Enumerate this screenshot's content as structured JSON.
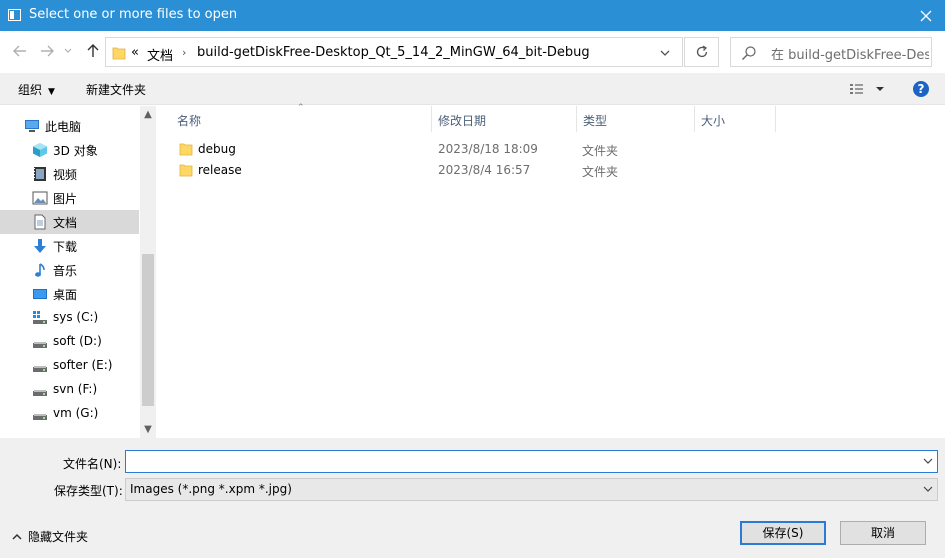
{
  "window": {
    "title": "Select one or more files to open"
  },
  "address": {
    "overflow": "«",
    "crumbs": [
      "文档",
      "build-getDiskFree-Desktop_Qt_5_14_2_MinGW_64_bit-Debug"
    ]
  },
  "search": {
    "placeholder": "在 build-getDiskFree-Des..."
  },
  "toolbar": {
    "organize": "组织",
    "new_folder": "新建文件夹",
    "help": "?"
  },
  "nav": {
    "items": [
      {
        "label": "此电脑",
        "icon": "computer-icon"
      },
      {
        "label": "3D 对象",
        "icon": "3d-objects-icon"
      },
      {
        "label": "视频",
        "icon": "video-icon"
      },
      {
        "label": "图片",
        "icon": "pictures-icon"
      },
      {
        "label": "文档",
        "icon": "documents-icon"
      },
      {
        "label": "下载",
        "icon": "download-icon"
      },
      {
        "label": "音乐",
        "icon": "music-icon"
      },
      {
        "label": "桌面",
        "icon": "desktop-icon"
      },
      {
        "label": "sys (C:)",
        "icon": "system-drive-icon"
      },
      {
        "label": "soft (D:)",
        "icon": "drive-icon"
      },
      {
        "label": "softer (E:)",
        "icon": "drive-icon"
      },
      {
        "label": "svn (F:)",
        "icon": "drive-icon"
      },
      {
        "label": "vm (G:)",
        "icon": "drive-icon"
      }
    ]
  },
  "columns": {
    "name": "名称",
    "date": "修改日期",
    "type": "类型",
    "size": "大小"
  },
  "files": [
    {
      "name": "debug",
      "date": "2023/8/18 18:09",
      "type": "文件夹"
    },
    {
      "name": "release",
      "date": "2023/8/4 16:57",
      "type": "文件夹"
    }
  ],
  "form": {
    "filename_label": "文件名(N):",
    "filename_value": "",
    "filetype_label": "保存类型(T):",
    "filetype_value": "Images (*.png *.xpm *.jpg)"
  },
  "footer": {
    "hide_folders": "隐藏文件夹",
    "save": "保存(S)",
    "cancel": "取消"
  },
  "colors": {
    "titlebar": "#2b8fd6",
    "accent": "#2b7bd6",
    "folder": "#ffd764"
  }
}
